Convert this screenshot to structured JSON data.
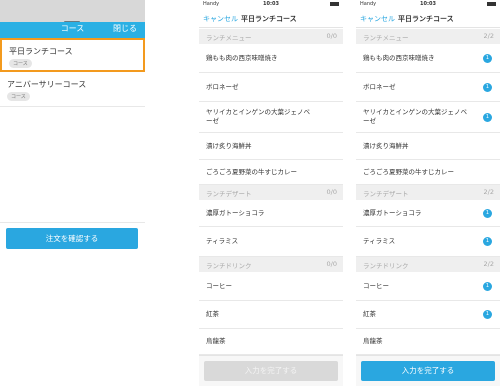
{
  "course_panel": {
    "header_title": "コース",
    "close_label": "閉じる",
    "courses": [
      {
        "name": "平日ランチコース",
        "tag": "コース",
        "selected": true
      },
      {
        "name": "アニバーサリーコース",
        "tag": "コース",
        "selected": false
      }
    ],
    "confirm_label": "注文を確認する"
  },
  "phones": [
    {
      "status": {
        "carrier": "Handy",
        "time": "10:03"
      },
      "nav": {
        "cancel": "キャンセル",
        "title": "平日ランチコース"
      },
      "sections": [
        {
          "label": "ランチメニュー",
          "count": "0/0",
          "items": [
            {
              "label": "鶏もも肉の西京味噌焼き",
              "badge": ""
            },
            {
              "label": "ボロネーゼ",
              "badge": ""
            },
            {
              "label": "ヤリイカとインゲンの大葉ジェノベーゼ",
              "badge": ""
            },
            {
              "label": "漬け炙り海鮮丼",
              "badge": ""
            },
            {
              "label": "ごろごろ夏野菜の牛すじカレー",
              "badge": ""
            }
          ]
        },
        {
          "label": "ランチデザート",
          "count": "0/0",
          "items": [
            {
              "label": "濃厚ガトーショコラ",
              "badge": ""
            },
            {
              "label": "ティラミス",
              "badge": ""
            }
          ]
        },
        {
          "label": "ランチドリンク",
          "count": "0/0",
          "items": [
            {
              "label": "コーヒー",
              "badge": ""
            },
            {
              "label": "紅茶",
              "badge": ""
            },
            {
              "label": "烏龍茶",
              "badge": ""
            }
          ]
        }
      ],
      "done_label": "入力を完了する",
      "done_enabled": false
    },
    {
      "status": {
        "carrier": "Handy",
        "time": "10:03"
      },
      "nav": {
        "cancel": "キャンセル",
        "title": "平日ランチコース"
      },
      "sections": [
        {
          "label": "ランチメニュー",
          "count": "2/2",
          "items": [
            {
              "label": "鶏もも肉の西京味噌焼き",
              "badge": "1"
            },
            {
              "label": "ボロネーゼ",
              "badge": "1"
            },
            {
              "label": "ヤリイカとインゲンの大葉ジェノベーゼ",
              "badge": "1"
            },
            {
              "label": "漬け炙り海鮮丼",
              "badge": ""
            },
            {
              "label": "ごろごろ夏野菜の牛すじカレー",
              "badge": ""
            }
          ]
        },
        {
          "label": "ランチデザート",
          "count": "2/2",
          "items": [
            {
              "label": "濃厚ガトーショコラ",
              "badge": "1"
            },
            {
              "label": "ティラミス",
              "badge": "1"
            }
          ]
        },
        {
          "label": "ランチドリンク",
          "count": "2/2",
          "items": [
            {
              "label": "コーヒー",
              "badge": "1"
            },
            {
              "label": "紅茶",
              "badge": "1"
            },
            {
              "label": "烏龍茶",
              "badge": ""
            }
          ]
        }
      ],
      "done_label": "入力を完了する",
      "done_enabled": true
    }
  ],
  "colors": {
    "accent": "#2aa7e0",
    "selected_border": "#f39a1e",
    "disabled": "#d9d9d9"
  }
}
